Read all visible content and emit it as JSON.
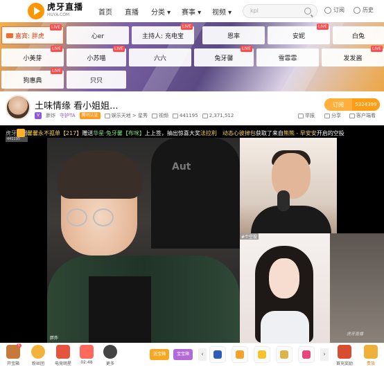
{
  "nav": {
    "logo_cn": "虎牙直播",
    "logo_en": "HUYA.COM",
    "items": [
      "首页",
      "直播",
      "分类 ▾",
      "赛事 ▾",
      "视频 ▾"
    ],
    "search_placeholder": "kpl",
    "subscribe": "订阅",
    "history": "历史"
  },
  "banner": {
    "guest": "嘉宾: 胖虎",
    "chips": [
      {
        "label": "心er",
        "live": false
      },
      {
        "label": "主持人: 充电宝",
        "live": true
      },
      {
        "label": "恩率",
        "live": false
      },
      {
        "label": "安妮",
        "live": true
      },
      {
        "label": "白兔",
        "live": false
      },
      {
        "label": "小美芽",
        "live": true
      },
      {
        "label": "小苏喵",
        "live": true
      },
      {
        "label": "六六",
        "live": false
      },
      {
        "label": "兔牙馨",
        "live": true
      },
      {
        "label": "雪霏霏",
        "live": false
      },
      {
        "label": "发发酱",
        "live": true
      },
      {
        "label": "狗惠典",
        "live": true
      },
      {
        "label": "只只",
        "live": false
      }
    ],
    "live_label": "LIVE"
  },
  "room": {
    "title": "土味情缘 看小姐姐...",
    "host": "胖炸",
    "guard": "守护TA",
    "cert": "腾讯认证",
    "category": "娱乐天地 > 星秀",
    "video": "视频",
    "room_id": "441195",
    "popularity": "2,371,512",
    "report": "举报",
    "share": "分享",
    "client": "客户端看",
    "subscribe": "订阅",
    "subscribe_count": "5324399"
  },
  "player": {
    "watermark": "虎牙直播",
    "watermark_id": "441195",
    "ticker": [
      {
        "text": "馨馨永不孤单【217】",
        "cls": "yel"
      },
      {
        "text": " 赠送 ",
        "cls": ""
      },
      {
        "text": "华星·兔牙馨【布咪】",
        "cls": "grn"
      },
      {
        "text": " 上上签，抽出惊喜大奖",
        "cls": ""
      },
      {
        "text": "法拉利",
        "cls": "yel"
      },
      {
        "text": "动态心彼掉包",
        "cls": "yel"
      },
      {
        "text": " 获取了来自 ",
        "cls": ""
      },
      {
        "text": "熊熊 - 早安安",
        "cls": "yel"
      },
      {
        "text": " 开启的空投",
        "cls": ""
      }
    ],
    "side_label": "#个空投",
    "streamer_tag": "胖炸",
    "corner_watermark": "虎牙直播"
  },
  "bottom": {
    "treasure": "开宝箱",
    "treasure_count": "6",
    "fans": "粉丝团",
    "star": "电竞明星",
    "timer": "02:48",
    "more": "更多",
    "pill1": "送宝箱",
    "pill2": "宝宝箱",
    "first_charge": "首充奖励",
    "noble": "贵族"
  }
}
